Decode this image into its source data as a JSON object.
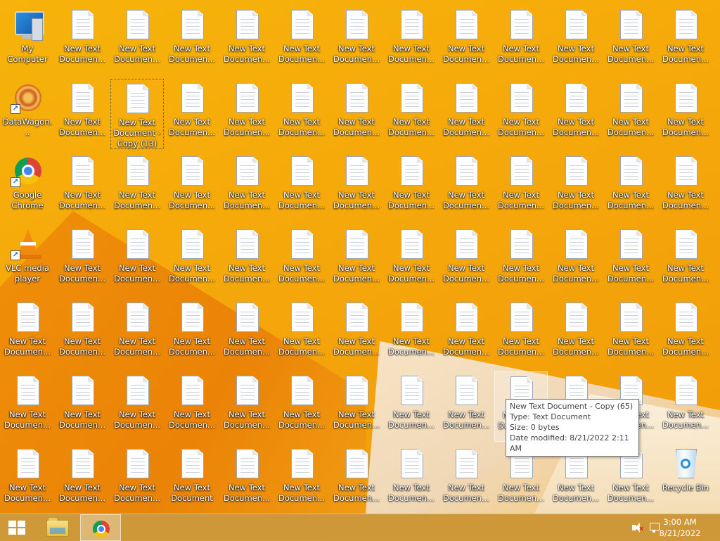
{
  "desktop": {
    "icons": [
      {
        "type": "computer",
        "label": "My Computer",
        "col": 0,
        "row": 0
      },
      {
        "type": "datawagon",
        "label": "DataWagon...",
        "col": 0,
        "row": 1,
        "shortcut": true
      },
      {
        "type": "chrome",
        "label": "Google Chrome",
        "col": 0,
        "row": 2,
        "shortcut": true
      },
      {
        "type": "vlc",
        "label": "VLC media player",
        "col": 0,
        "row": 3,
        "shortcut": true
      },
      {
        "type": "recycle",
        "label": "Recycle Bin",
        "col": 12,
        "row": 6
      }
    ],
    "docs": {
      "label": "New Text Documen...",
      "full_label": "New Text Document",
      "selected_label": "New Text Document - Copy (13)"
    }
  },
  "tooltip": {
    "name": "New Text Document - Copy (65)",
    "type": "Type: Text Document",
    "size": "Size: 0 bytes",
    "date": "Date modified: 8/21/2022 2:11 AM"
  },
  "taskbar": {
    "start": "start-button",
    "explorer": "file-explorer",
    "chrome": "google-chrome",
    "clock": {
      "time": "3:00 AM",
      "date": "8/21/2022"
    }
  },
  "colors": {
    "wallpaper": "#f4a50a",
    "taskbar": "#c49646",
    "tooltip_border": "#767676"
  }
}
